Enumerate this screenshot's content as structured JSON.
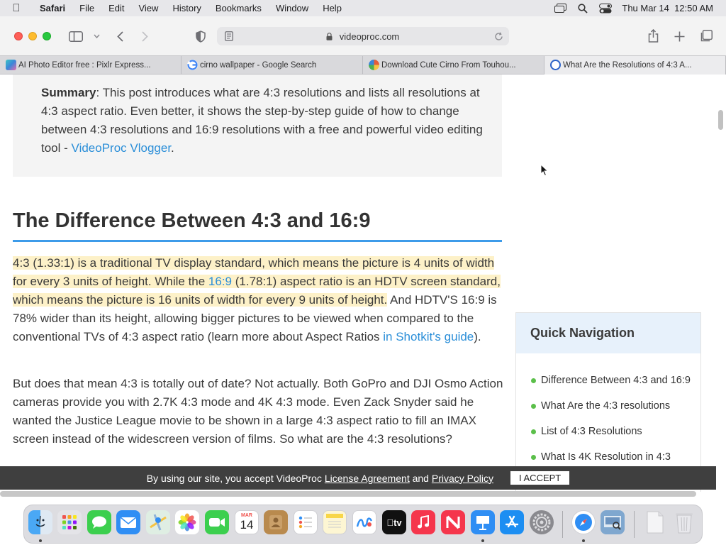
{
  "menubar": {
    "app_name": "Safari",
    "items": [
      "File",
      "Edit",
      "View",
      "History",
      "Bookmarks",
      "Window",
      "Help"
    ],
    "clock": "Thu Mar 14  12:50 AM"
  },
  "toolbar": {
    "url": "videoproc.com"
  },
  "tabs": [
    {
      "title": "AI Photo Editor free : Pixlr Express...",
      "favicon_color": "#3a86d9"
    },
    {
      "title": "cirno wallpaper - Google Search",
      "favicon_color": "#4285f4"
    },
    {
      "title": "Download Cute Cirno From Touhou...",
      "favicon_color": "#e45d3a"
    },
    {
      "title": "What Are the Resolutions of 4:3 A...",
      "favicon_color": "#2b62c8"
    }
  ],
  "article": {
    "summary_label": "Summary",
    "summary_text": ": This post introduces what are 4:3 resolutions and lists all resolutions at 4:3 aspect ratio. Even better, it shows the step-by-step guide of how to change between 4:3 resolutions and 16:9 resolutions with a free and powerful video editing tool - ",
    "summary_link": "VideoProc Vlogger",
    "summary_end": ".",
    "heading": "The Difference Between 4:3 and 16:9",
    "p1_hl_a": "4:3 (1.33:1) is a traditional TV display standard, which means the picture is 4 units of width for every 3 units of height. While the ",
    "p1_link_169": "16:9",
    "p1_hl_b": " (1.78:1) aspect ratio is an HDTV screen standard, which means the picture is 16 units of width for every 9 units of height.",
    "p1_rest": " And HDTV'S 16:9 is 78% wider than its height, allowing bigger pictures to be viewed when compared to the conventional TVs of 4:3 aspect ratio (learn more about Aspect Ratios ",
    "p1_link_shotkit": "in Shotkit's guide",
    "p1_end": ").",
    "p2": "But does that mean 4:3 is totally out of date? Not actually. Both GoPro and DJI Osmo Action cameras provide you with 2.7K 4:3 mode and 4K 4:3 mode. Even Zack Snyder said he wanted the Justice League movie to be shown in a large 4:3 aspect ratio to fill an IMAX screen instead of the widescreen version of films. So what are the 4:3 resolutions?"
  },
  "quick_nav": {
    "title": "Quick Navigation",
    "items": [
      "Difference Between 4:3 and 16:9",
      "What Are the 4:3 resolutions",
      "List of 4:3 Resolutions",
      "What Is 4K Resolution in 4:3"
    ]
  },
  "banner": {
    "text_before": "By using our site, you accept VideoProc ",
    "license": "License Agreement",
    "and": " and ",
    "privacy": "Privacy Policy",
    "accept": "I ACCEPT"
  },
  "dock": {
    "calendar_month": "MAR",
    "calendar_day": "14",
    "tv_label": "tv"
  },
  "colors": {
    "link": "#2a8ed8",
    "heading_rule": "#3d9be9",
    "highlight": "#fdf1c8",
    "banner_bg": "#3f3f3f"
  }
}
